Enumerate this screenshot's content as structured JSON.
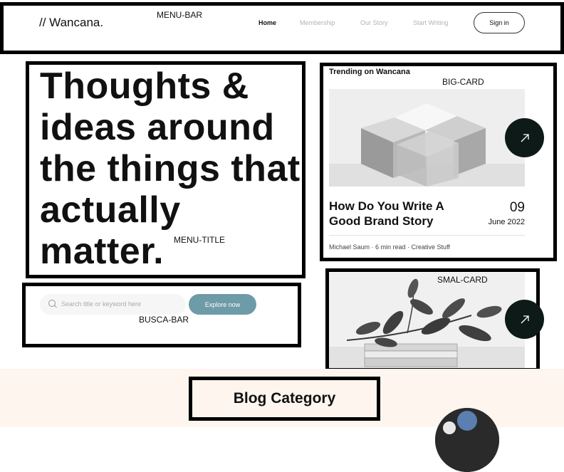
{
  "annotations": {
    "menu_bar": "MENU-BAR",
    "big_card": "BIG-CARD",
    "menu_title": "MENU-TITLE",
    "busca_bar": "BUSCA-BAR",
    "small_card": "SMAL-CARD"
  },
  "header": {
    "logo": "// Wancana.",
    "nav": [
      "Home",
      "Membership",
      "Our Story",
      "Start Writing"
    ],
    "signin": "Sign in"
  },
  "hero": {
    "headline": "Thoughts & ideas around the things that actually matter."
  },
  "search": {
    "placeholder": "Search title or keyword here",
    "button": "Explore now"
  },
  "trending": {
    "heading": "Trending on Wancana",
    "title": "How Do You Write A Good Brand Story",
    "day": "09",
    "month_year": "June 2022",
    "meta": "Michael Saum · 6 min read · Creative Stuff"
  },
  "categories": {
    "heading": "Blog Category"
  },
  "colors": {
    "accent": "#6e9ba8",
    "arrow_button": "#0d1a17",
    "section_bg": "#fdf5ee"
  },
  "icons": {
    "search": "search-icon",
    "arrow": "arrow-up-right-icon"
  }
}
